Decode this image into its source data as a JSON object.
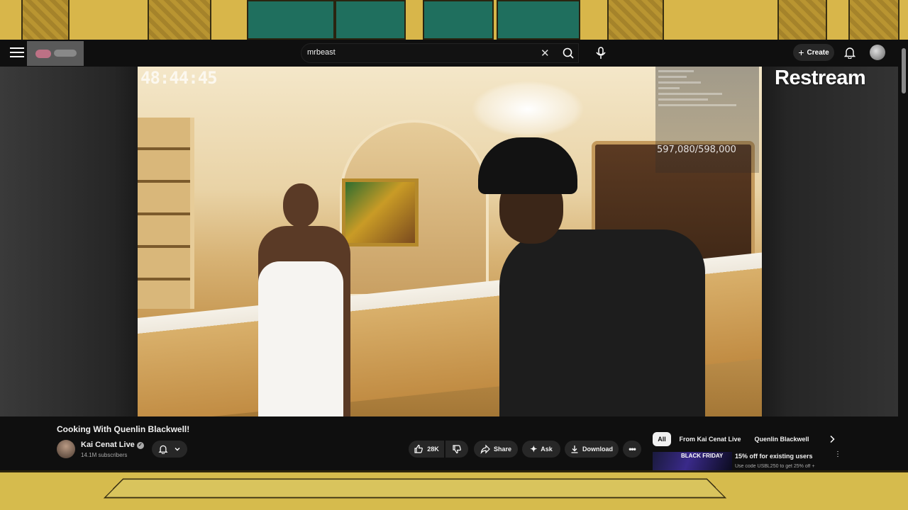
{
  "overlay": {
    "brand": "Restream"
  },
  "header": {
    "search_value": "mrbeast",
    "create_label": "Create"
  },
  "player": {
    "timer": "48:44:45",
    "goal_text": "597,080/598,000"
  },
  "video": {
    "title": "Cooking With Quenlin Blackwell!",
    "channel_name": "Kai Cenat Live",
    "subscribers": "14.1M subscribers",
    "likes": "28K",
    "share_label": "Share",
    "ask_label": "Ask",
    "download_label": "Download"
  },
  "chips": [
    "All",
    "From Kai Cenat Live",
    "Quenlin Blackwell"
  ],
  "ad": {
    "title": "15% off for existing users",
    "subtitle": "Use code USBL250 to get 25% off +",
    "thumb_text": "BLACK FRIDAY"
  },
  "colors": {
    "background": "#0f0f0f",
    "button": "#272727",
    "chip_selected": "#f1f1f1"
  }
}
